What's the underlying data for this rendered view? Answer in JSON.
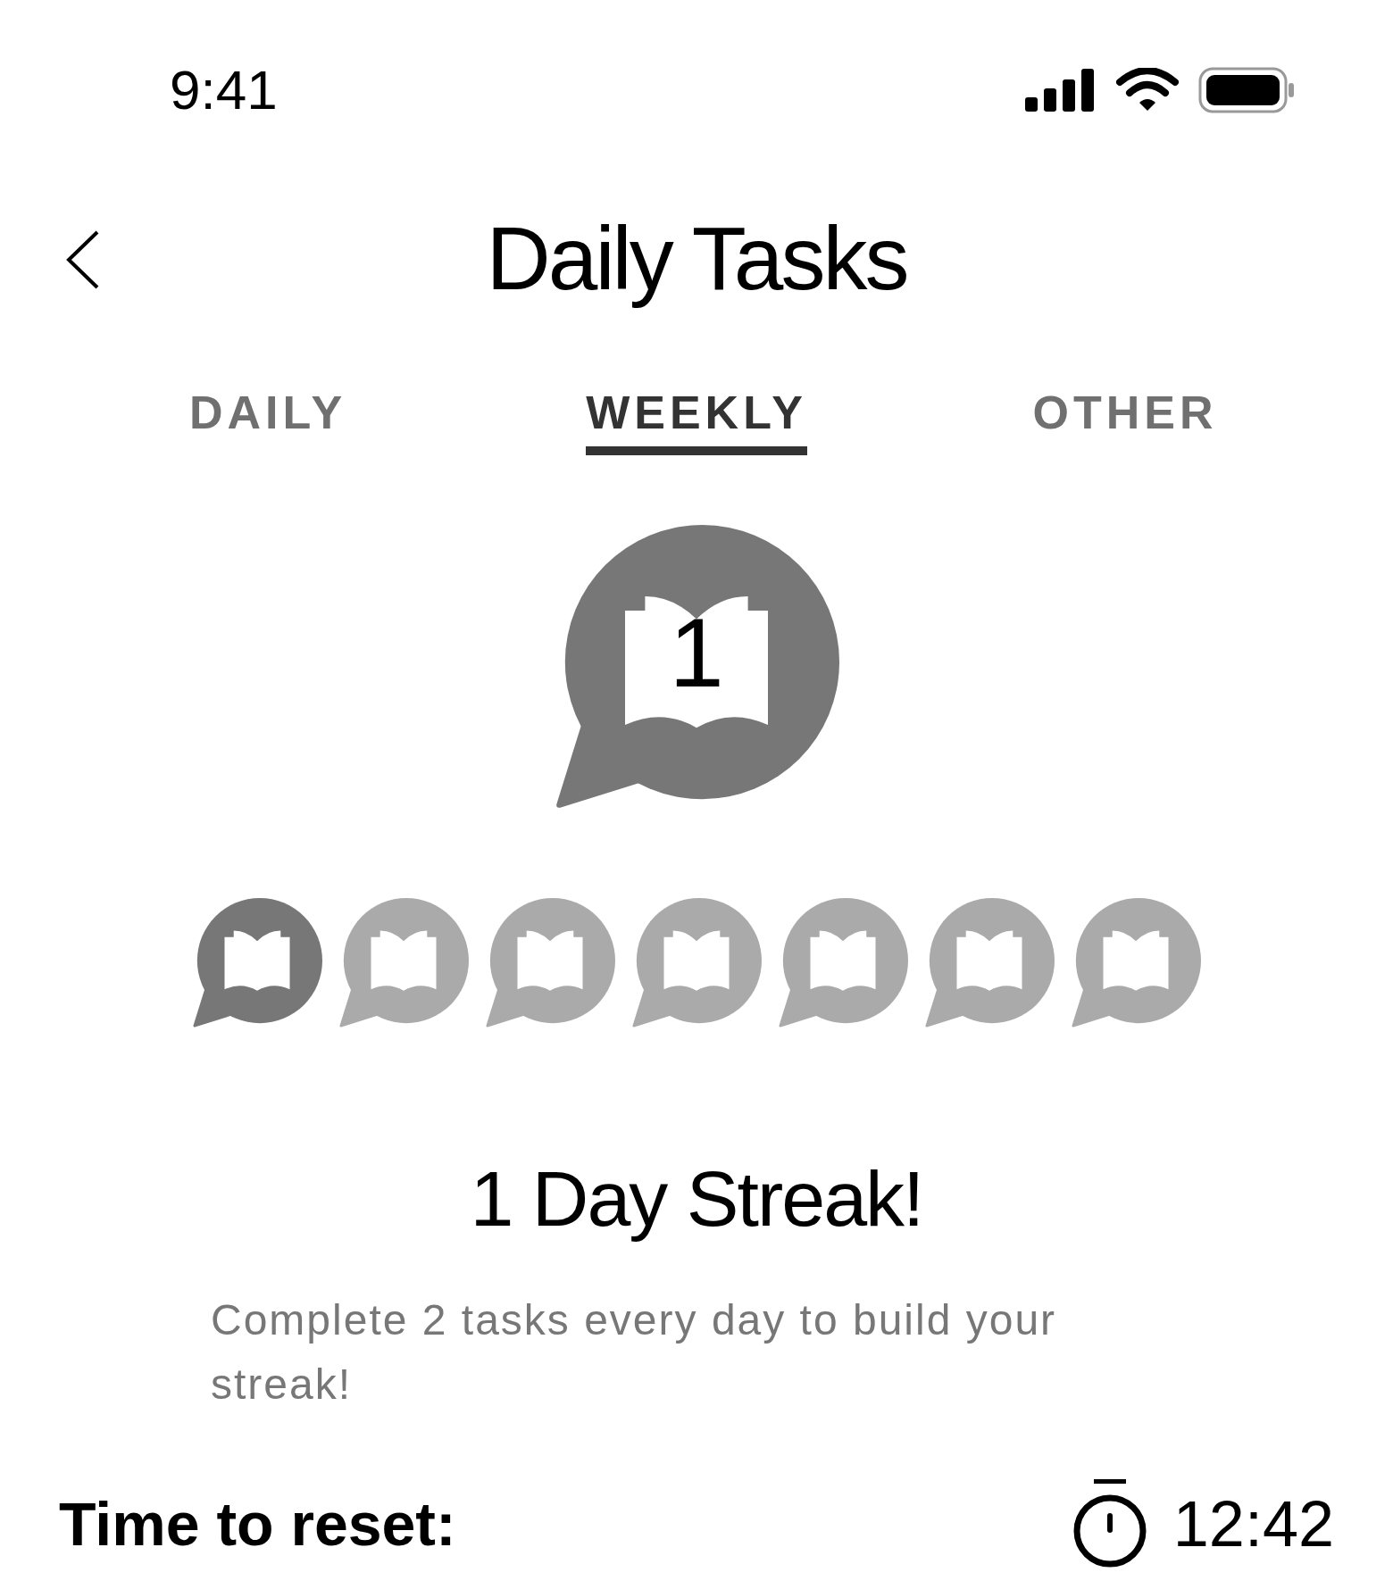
{
  "status_bar": {
    "time": "9:41"
  },
  "header": {
    "title": "Daily Tasks"
  },
  "tabs": [
    {
      "label": "DAILY",
      "selected": false
    },
    {
      "label": "WEEKLY",
      "selected": true
    },
    {
      "label": "OTHER",
      "selected": false
    }
  ],
  "streak": {
    "count": "1",
    "days": [
      {
        "completed": true
      },
      {
        "completed": false
      },
      {
        "completed": false
      },
      {
        "completed": false
      },
      {
        "completed": false
      },
      {
        "completed": false
      },
      {
        "completed": false
      }
    ],
    "title": "1 Day Streak!",
    "description": "Complete 2 tasks every day to build your streak!"
  },
  "reset": {
    "label": "Time to reset:",
    "time": "12:42"
  }
}
